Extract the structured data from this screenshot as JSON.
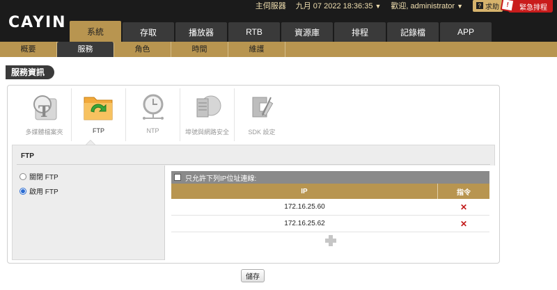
{
  "brand": {
    "logo_text": "CAYIN"
  },
  "topbar": {
    "server": "主伺服器",
    "datetime": "九月 07 2022 18:36:35",
    "user": "歡迎, administrator",
    "help": "求助",
    "emergency": "緊急排程"
  },
  "main_tabs": [
    "系統",
    "存取",
    "播放器",
    "RTB",
    "資源庫",
    "排程",
    "記錄檔",
    "APP"
  ],
  "sub_nav": [
    "概要",
    "服務",
    "角色",
    "時間",
    "維護"
  ],
  "section_title": "服務資訊",
  "services": [
    {
      "label": "多媒體檔案夾",
      "icon": "media-folder-icon"
    },
    {
      "label": "FTP",
      "icon": "ftp-folder-icon"
    },
    {
      "label": "NTP",
      "icon": "ntp-clock-icon"
    },
    {
      "label": "埠號與網路安全",
      "icon": "network-security-icon"
    },
    {
      "label": "SDK 設定",
      "icon": "sdk-settings-icon"
    }
  ],
  "ftp": {
    "title": "FTP",
    "disable_label": "關閉 FTP",
    "enable_label": "啟用 FTP",
    "enabled": true,
    "allow_label": "只允許下列IP位址連線:",
    "allow_checked": false,
    "col_ip": "IP",
    "col_cmd": "指令",
    "rows": [
      {
        "ip": "172.16.25.60",
        "action": "✕"
      },
      {
        "ip": "172.16.25.62",
        "action": "✕"
      }
    ]
  },
  "save_label": "儲存"
}
